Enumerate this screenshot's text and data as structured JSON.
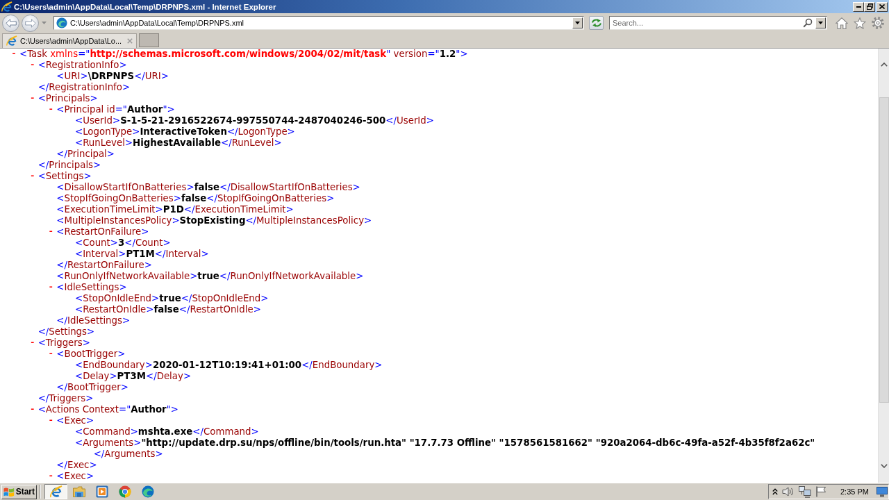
{
  "window": {
    "title": "C:\\Users\\admin\\AppData\\Local\\Temp\\DRPNPS.xml - Internet Explorer"
  },
  "address_bar": {
    "value": "C:\\Users\\admin\\AppData\\Local\\Temp\\DRPNPS.xml"
  },
  "search": {
    "placeholder": "Search..."
  },
  "tabs": [
    {
      "label": "C:\\Users\\admin\\AppData\\Lo...",
      "selected": true
    }
  ],
  "document": {
    "nodes": [
      {
        "toggle": "-",
        "open": [
          {
            "kind": "markup",
            "text": "<"
          },
          {
            "kind": "name",
            "text": "Task"
          },
          {
            "kind": "namespace",
            "text": " xmlns"
          },
          {
            "kind": "markup",
            "text": "=\""
          },
          {
            "kind": "nsvalue",
            "text": "http://schemas.microsoft.com/windows/2004/02/mit/task"
          },
          {
            "kind": "markup",
            "text": "\""
          },
          {
            "kind": "name",
            "text": " version"
          },
          {
            "kind": "markup",
            "text": "=\""
          },
          {
            "kind": "text",
            "text": "1.2"
          },
          {
            "kind": "markup",
            "text": "\">"
          }
        ],
        "children": [
          {
            "toggle": "-",
            "open": [
              {
                "kind": "markup",
                "text": "<"
              },
              {
                "kind": "name",
                "text": "RegistrationInfo"
              },
              {
                "kind": "markup",
                "text": ">"
              }
            ],
            "children": [
              {
                "open": [
                  {
                    "kind": "markup",
                    "text": "<"
                  },
                  {
                    "kind": "name",
                    "text": "URI"
                  },
                  {
                    "kind": "markup",
                    "text": ">"
                  },
                  {
                    "kind": "text",
                    "text": "\\DRPNPS"
                  },
                  {
                    "kind": "markup",
                    "text": "</"
                  },
                  {
                    "kind": "name",
                    "text": "URI"
                  },
                  {
                    "kind": "markup",
                    "text": ">"
                  }
                ]
              }
            ],
            "close": [
              {
                "kind": "markup",
                "text": "</"
              },
              {
                "kind": "name",
                "text": "RegistrationInfo"
              },
              {
                "kind": "markup",
                "text": ">"
              }
            ]
          },
          {
            "toggle": "-",
            "open": [
              {
                "kind": "markup",
                "text": "<"
              },
              {
                "kind": "name",
                "text": "Principals"
              },
              {
                "kind": "markup",
                "text": ">"
              }
            ],
            "children": [
              {
                "toggle": "-",
                "open": [
                  {
                    "kind": "markup",
                    "text": "<"
                  },
                  {
                    "kind": "name",
                    "text": "Principal"
                  },
                  {
                    "kind": "name",
                    "text": " id"
                  },
                  {
                    "kind": "markup",
                    "text": "=\""
                  },
                  {
                    "kind": "text",
                    "text": "Author"
                  },
                  {
                    "kind": "markup",
                    "text": "\">"
                  }
                ],
                "children": [
                  {
                    "open": [
                      {
                        "kind": "markup",
                        "text": "<"
                      },
                      {
                        "kind": "name",
                        "text": "UserId"
                      },
                      {
                        "kind": "markup",
                        "text": ">"
                      },
                      {
                        "kind": "text",
                        "text": "S-1-5-21-2916522674-997550744-2487040246-500"
                      },
                      {
                        "kind": "markup",
                        "text": "</"
                      },
                      {
                        "kind": "name",
                        "text": "UserId"
                      },
                      {
                        "kind": "markup",
                        "text": ">"
                      }
                    ]
                  },
                  {
                    "open": [
                      {
                        "kind": "markup",
                        "text": "<"
                      },
                      {
                        "kind": "name",
                        "text": "LogonType"
                      },
                      {
                        "kind": "markup",
                        "text": ">"
                      },
                      {
                        "kind": "text",
                        "text": "InteractiveToken"
                      },
                      {
                        "kind": "markup",
                        "text": "</"
                      },
                      {
                        "kind": "name",
                        "text": "LogonType"
                      },
                      {
                        "kind": "markup",
                        "text": ">"
                      }
                    ]
                  },
                  {
                    "open": [
                      {
                        "kind": "markup",
                        "text": "<"
                      },
                      {
                        "kind": "name",
                        "text": "RunLevel"
                      },
                      {
                        "kind": "markup",
                        "text": ">"
                      },
                      {
                        "kind": "text",
                        "text": "HighestAvailable"
                      },
                      {
                        "kind": "markup",
                        "text": "</"
                      },
                      {
                        "kind": "name",
                        "text": "RunLevel"
                      },
                      {
                        "kind": "markup",
                        "text": ">"
                      }
                    ]
                  }
                ],
                "close": [
                  {
                    "kind": "markup",
                    "text": "</"
                  },
                  {
                    "kind": "name",
                    "text": "Principal"
                  },
                  {
                    "kind": "markup",
                    "text": ">"
                  }
                ]
              }
            ],
            "close": [
              {
                "kind": "markup",
                "text": "</"
              },
              {
                "kind": "name",
                "text": "Principals"
              },
              {
                "kind": "markup",
                "text": ">"
              }
            ]
          },
          {
            "toggle": "-",
            "open": [
              {
                "kind": "markup",
                "text": "<"
              },
              {
                "kind": "name",
                "text": "Settings"
              },
              {
                "kind": "markup",
                "text": ">"
              }
            ],
            "children": [
              {
                "open": [
                  {
                    "kind": "markup",
                    "text": "<"
                  },
                  {
                    "kind": "name",
                    "text": "DisallowStartIfOnBatteries"
                  },
                  {
                    "kind": "markup",
                    "text": ">"
                  },
                  {
                    "kind": "text",
                    "text": "false"
                  },
                  {
                    "kind": "markup",
                    "text": "</"
                  },
                  {
                    "kind": "name",
                    "text": "DisallowStartIfOnBatteries"
                  },
                  {
                    "kind": "markup",
                    "text": ">"
                  }
                ]
              },
              {
                "open": [
                  {
                    "kind": "markup",
                    "text": "<"
                  },
                  {
                    "kind": "name",
                    "text": "StopIfGoingOnBatteries"
                  },
                  {
                    "kind": "markup",
                    "text": ">"
                  },
                  {
                    "kind": "text",
                    "text": "false"
                  },
                  {
                    "kind": "markup",
                    "text": "</"
                  },
                  {
                    "kind": "name",
                    "text": "StopIfGoingOnBatteries"
                  },
                  {
                    "kind": "markup",
                    "text": ">"
                  }
                ]
              },
              {
                "open": [
                  {
                    "kind": "markup",
                    "text": "<"
                  },
                  {
                    "kind": "name",
                    "text": "ExecutionTimeLimit"
                  },
                  {
                    "kind": "markup",
                    "text": ">"
                  },
                  {
                    "kind": "text",
                    "text": "P1D"
                  },
                  {
                    "kind": "markup",
                    "text": "</"
                  },
                  {
                    "kind": "name",
                    "text": "ExecutionTimeLimit"
                  },
                  {
                    "kind": "markup",
                    "text": ">"
                  }
                ]
              },
              {
                "open": [
                  {
                    "kind": "markup",
                    "text": "<"
                  },
                  {
                    "kind": "name",
                    "text": "MultipleInstancesPolicy"
                  },
                  {
                    "kind": "markup",
                    "text": ">"
                  },
                  {
                    "kind": "text",
                    "text": "StopExisting"
                  },
                  {
                    "kind": "markup",
                    "text": "</"
                  },
                  {
                    "kind": "name",
                    "text": "MultipleInstancesPolicy"
                  },
                  {
                    "kind": "markup",
                    "text": ">"
                  }
                ]
              },
              {
                "toggle": "-",
                "open": [
                  {
                    "kind": "markup",
                    "text": "<"
                  },
                  {
                    "kind": "name",
                    "text": "RestartOnFailure"
                  },
                  {
                    "kind": "markup",
                    "text": ">"
                  }
                ],
                "children": [
                  {
                    "open": [
                      {
                        "kind": "markup",
                        "text": "<"
                      },
                      {
                        "kind": "name",
                        "text": "Count"
                      },
                      {
                        "kind": "markup",
                        "text": ">"
                      },
                      {
                        "kind": "text",
                        "text": "3"
                      },
                      {
                        "kind": "markup",
                        "text": "</"
                      },
                      {
                        "kind": "name",
                        "text": "Count"
                      },
                      {
                        "kind": "markup",
                        "text": ">"
                      }
                    ]
                  },
                  {
                    "open": [
                      {
                        "kind": "markup",
                        "text": "<"
                      },
                      {
                        "kind": "name",
                        "text": "Interval"
                      },
                      {
                        "kind": "markup",
                        "text": ">"
                      },
                      {
                        "kind": "text",
                        "text": "PT1M"
                      },
                      {
                        "kind": "markup",
                        "text": "</"
                      },
                      {
                        "kind": "name",
                        "text": "Interval"
                      },
                      {
                        "kind": "markup",
                        "text": ">"
                      }
                    ]
                  }
                ],
                "close": [
                  {
                    "kind": "markup",
                    "text": "</"
                  },
                  {
                    "kind": "name",
                    "text": "RestartOnFailure"
                  },
                  {
                    "kind": "markup",
                    "text": ">"
                  }
                ]
              },
              {
                "open": [
                  {
                    "kind": "markup",
                    "text": "<"
                  },
                  {
                    "kind": "name",
                    "text": "RunOnlyIfNetworkAvailable"
                  },
                  {
                    "kind": "markup",
                    "text": ">"
                  },
                  {
                    "kind": "text",
                    "text": "true"
                  },
                  {
                    "kind": "markup",
                    "text": "</"
                  },
                  {
                    "kind": "name",
                    "text": "RunOnlyIfNetworkAvailable"
                  },
                  {
                    "kind": "markup",
                    "text": ">"
                  }
                ]
              },
              {
                "toggle": "-",
                "open": [
                  {
                    "kind": "markup",
                    "text": "<"
                  },
                  {
                    "kind": "name",
                    "text": "IdleSettings"
                  },
                  {
                    "kind": "markup",
                    "text": ">"
                  }
                ],
                "children": [
                  {
                    "open": [
                      {
                        "kind": "markup",
                        "text": "<"
                      },
                      {
                        "kind": "name",
                        "text": "StopOnIdleEnd"
                      },
                      {
                        "kind": "markup",
                        "text": ">"
                      },
                      {
                        "kind": "text",
                        "text": "true"
                      },
                      {
                        "kind": "markup",
                        "text": "</"
                      },
                      {
                        "kind": "name",
                        "text": "StopOnIdleEnd"
                      },
                      {
                        "kind": "markup",
                        "text": ">"
                      }
                    ]
                  },
                  {
                    "open": [
                      {
                        "kind": "markup",
                        "text": "<"
                      },
                      {
                        "kind": "name",
                        "text": "RestartOnIdle"
                      },
                      {
                        "kind": "markup",
                        "text": ">"
                      },
                      {
                        "kind": "text",
                        "text": "false"
                      },
                      {
                        "kind": "markup",
                        "text": "</"
                      },
                      {
                        "kind": "name",
                        "text": "RestartOnIdle"
                      },
                      {
                        "kind": "markup",
                        "text": ">"
                      }
                    ]
                  }
                ],
                "close": [
                  {
                    "kind": "markup",
                    "text": "</"
                  },
                  {
                    "kind": "name",
                    "text": "IdleSettings"
                  },
                  {
                    "kind": "markup",
                    "text": ">"
                  }
                ]
              }
            ],
            "close": [
              {
                "kind": "markup",
                "text": "</"
              },
              {
                "kind": "name",
                "text": "Settings"
              },
              {
                "kind": "markup",
                "text": ">"
              }
            ]
          },
          {
            "toggle": "-",
            "open": [
              {
                "kind": "markup",
                "text": "<"
              },
              {
                "kind": "name",
                "text": "Triggers"
              },
              {
                "kind": "markup",
                "text": ">"
              }
            ],
            "children": [
              {
                "toggle": "-",
                "open": [
                  {
                    "kind": "markup",
                    "text": "<"
                  },
                  {
                    "kind": "name",
                    "text": "BootTrigger"
                  },
                  {
                    "kind": "markup",
                    "text": ">"
                  }
                ],
                "children": [
                  {
                    "open": [
                      {
                        "kind": "markup",
                        "text": "<"
                      },
                      {
                        "kind": "name",
                        "text": "EndBoundary"
                      },
                      {
                        "kind": "markup",
                        "text": ">"
                      },
                      {
                        "kind": "text",
                        "text": "2020-01-12T10:19:41+01:00"
                      },
                      {
                        "kind": "markup",
                        "text": "</"
                      },
                      {
                        "kind": "name",
                        "text": "EndBoundary"
                      },
                      {
                        "kind": "markup",
                        "text": ">"
                      }
                    ]
                  },
                  {
                    "open": [
                      {
                        "kind": "markup",
                        "text": "<"
                      },
                      {
                        "kind": "name",
                        "text": "Delay"
                      },
                      {
                        "kind": "markup",
                        "text": ">"
                      },
                      {
                        "kind": "text",
                        "text": "PT3M"
                      },
                      {
                        "kind": "markup",
                        "text": "</"
                      },
                      {
                        "kind": "name",
                        "text": "Delay"
                      },
                      {
                        "kind": "markup",
                        "text": ">"
                      }
                    ]
                  }
                ],
                "close": [
                  {
                    "kind": "markup",
                    "text": "</"
                  },
                  {
                    "kind": "name",
                    "text": "BootTrigger"
                  },
                  {
                    "kind": "markup",
                    "text": ">"
                  }
                ]
              }
            ],
            "close": [
              {
                "kind": "markup",
                "text": "</"
              },
              {
                "kind": "name",
                "text": "Triggers"
              },
              {
                "kind": "markup",
                "text": ">"
              }
            ]
          },
          {
            "toggle": "-",
            "open": [
              {
                "kind": "markup",
                "text": "<"
              },
              {
                "kind": "name",
                "text": "Actions"
              },
              {
                "kind": "name",
                "text": " Context"
              },
              {
                "kind": "markup",
                "text": "=\""
              },
              {
                "kind": "text",
                "text": "Author"
              },
              {
                "kind": "markup",
                "text": "\">"
              }
            ],
            "children": [
              {
                "toggle": "-",
                "open": [
                  {
                    "kind": "markup",
                    "text": "<"
                  },
                  {
                    "kind": "name",
                    "text": "Exec"
                  },
                  {
                    "kind": "markup",
                    "text": ">"
                  }
                ],
                "children": [
                  {
                    "open": [
                      {
                        "kind": "markup",
                        "text": "<"
                      },
                      {
                        "kind": "name",
                        "text": "Command"
                      },
                      {
                        "kind": "markup",
                        "text": ">"
                      },
                      {
                        "kind": "text",
                        "text": "mshta.exe"
                      },
                      {
                        "kind": "markup",
                        "text": "</"
                      },
                      {
                        "kind": "name",
                        "text": "Command"
                      },
                      {
                        "kind": "markup",
                        "text": ">"
                      }
                    ]
                  },
                  {
                    "open": [
                      {
                        "kind": "markup",
                        "text": "<"
                      },
                      {
                        "kind": "name",
                        "text": "Arguments"
                      },
                      {
                        "kind": "markup",
                        "text": ">"
                      },
                      {
                        "kind": "text",
                        "text": "\"http://update.drp.su/nps/offline/bin/tools/run.hta\" \"17.7.73 Offline\" \"1578561581662\" \"920a2064-db6c-49fa-a52f-4b35f8f2a62c\""
                      },
                      {
                        "kind": "markup",
                        "text": "</"
                      },
                      {
                        "kind": "name",
                        "text": "Arguments"
                      },
                      {
                        "kind": "markup",
                        "text": ">"
                      }
                    ]
                  }
                ],
                "close": [
                  {
                    "kind": "markup",
                    "text": "</"
                  },
                  {
                    "kind": "name",
                    "text": "Exec"
                  },
                  {
                    "kind": "markup",
                    "text": ">"
                  }
                ]
              },
              {
                "toggle": "-",
                "open": [
                  {
                    "kind": "markup",
                    "text": "<"
                  },
                  {
                    "kind": "name",
                    "text": "Exec"
                  },
                  {
                    "kind": "markup",
                    "text": ">"
                  }
                ]
              }
            ]
          }
        ]
      }
    ]
  },
  "taskbar": {
    "start": "Start",
    "apps": [
      {
        "kind": "e-logo",
        "selected": true
      },
      {
        "kind": "folder",
        "selected": false
      },
      {
        "kind": "media",
        "selected": false
      },
      {
        "kind": "ring",
        "selected": false
      },
      {
        "kind": "wave",
        "selected": false
      }
    ],
    "clock": "2:35 PM"
  }
}
